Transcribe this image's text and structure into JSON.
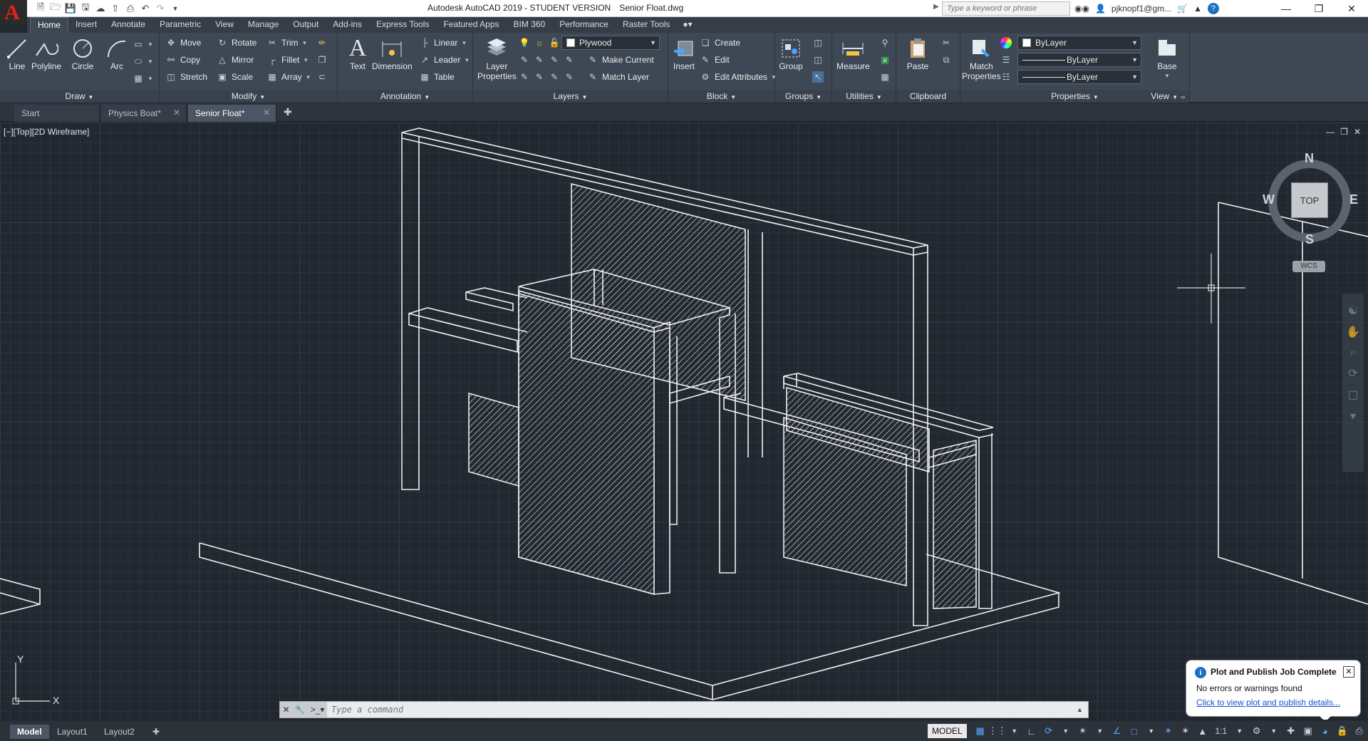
{
  "title": {
    "app": "Autodesk AutoCAD 2019 - STUDENT VERSION",
    "file": "Senior Float.dwg",
    "search_placeholder": "Type a keyword or phrase",
    "user": "pjknopf1@gm..."
  },
  "ribbon_tabs": [
    "Home",
    "Insert",
    "Annotate",
    "Parametric",
    "View",
    "Manage",
    "Output",
    "Add-ins",
    "Express Tools",
    "Featured Apps",
    "BIM 360",
    "Performance",
    "Raster Tools"
  ],
  "panels": {
    "draw": {
      "title": "Draw",
      "line": "Line",
      "polyline": "Polyline",
      "circle": "Circle",
      "arc": "Arc"
    },
    "modify": {
      "title": "Modify",
      "move": "Move",
      "rotate": "Rotate",
      "trim": "Trim",
      "copy": "Copy",
      "mirror": "Mirror",
      "fillet": "Fillet",
      "stretch": "Stretch",
      "scale": "Scale",
      "array": "Array"
    },
    "annotation": {
      "title": "Annotation",
      "text": "Text",
      "dimension": "Dimension",
      "linear": "Linear",
      "leader": "Leader",
      "table": "Table"
    },
    "layers": {
      "title": "Layers",
      "layer_properties_1": "Layer",
      "layer_properties_2": "Properties",
      "current_layer": "Plywood",
      "make_current": "Make Current",
      "match_layer": "Match Layer"
    },
    "block": {
      "title": "Block",
      "insert": "Insert",
      "create": "Create",
      "edit": "Edit",
      "edit_attributes": "Edit Attributes"
    },
    "groups": {
      "title": "Groups",
      "group": "Group"
    },
    "utilities": {
      "title": "Utilities",
      "measure": "Measure"
    },
    "clipboard": {
      "title": "Clipboard",
      "paste": "Paste"
    },
    "properties": {
      "title": "Properties",
      "match_1": "Match",
      "match_2": "Properties",
      "color": "ByLayer",
      "linetype": "ByLayer",
      "lineweight": "ByLayer"
    },
    "view": {
      "title": "View",
      "base": "Base"
    }
  },
  "file_tabs": [
    {
      "label": "Start",
      "active": false
    },
    {
      "label": "Physics Boat*",
      "active": false
    },
    {
      "label": "Senior Float*",
      "active": true
    }
  ],
  "viewport": {
    "label": "[−][Top][2D Wireframe]",
    "compass": {
      "n": "N",
      "s": "S",
      "e": "E",
      "w": "W",
      "cube": "TOP",
      "wcs": "WCS"
    },
    "ucs_x": "X",
    "ucs_y": "Y"
  },
  "command": {
    "placeholder": "Type a command"
  },
  "notification": {
    "title": "Plot and Publish Job Complete",
    "message": "No errors or warnings found",
    "link": "Click to view plot and publish details..."
  },
  "layout_tabs": [
    "Model",
    "Layout1",
    "Layout2"
  ],
  "status": {
    "model": "MODEL",
    "scale": "1:1"
  },
  "colors": {
    "background": "#212830",
    "ribbon": "#3e4754",
    "accent": "#53a6ff",
    "logo": "#e2231a"
  }
}
